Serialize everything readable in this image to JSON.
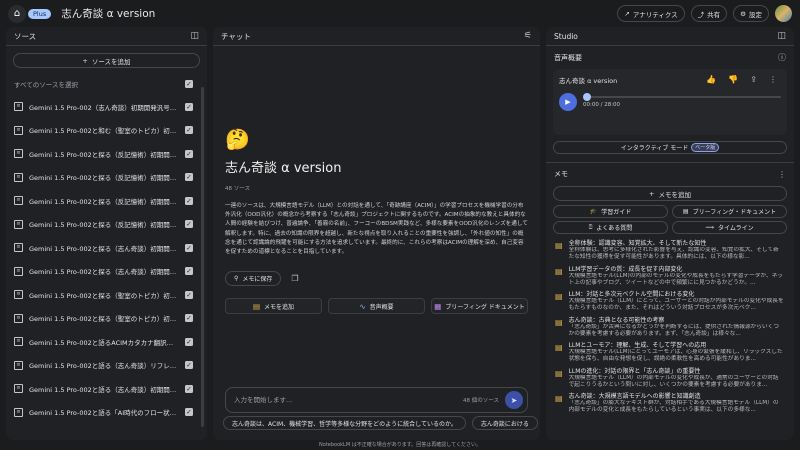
{
  "header": {
    "logo": "notebooklm-logo",
    "plus_badge": "Plus",
    "title": "志ん奇談 α version",
    "analytics_label": "アナリティクス",
    "share_label": "共有",
    "settings_label": "設定"
  },
  "sources": {
    "panel_title": "ソース",
    "add_label": "ソースを追加",
    "select_all_label": "すべてのソースを選択",
    "items": [
      {
        "label": "Gemini 1.5 Pro-002（志ん奇談）初期開発汎号スレッ..."
      },
      {
        "label": "Gemini 1.5 Pro-002と和む（聖室のトピカ）初期開発..."
      },
      {
        "label": "Gemini 1.5 Pro-002と探る（反記憶術）初期開発#01:..."
      },
      {
        "label": "Gemini 1.5 Pro-002と探る（反記憶術）初期開発#02:..."
      },
      {
        "label": "Gemini 1.5 Pro-002と探る（反記憶術）初期開発#04:..."
      },
      {
        "label": "Gemini 1.5 Pro-002と探る（反記憶術）初期開発#05:..."
      },
      {
        "label": "Gemini 1.5 Pro-002と探る（志ん奇談）初期開発：（承..."
      },
      {
        "label": "Gemini 1.5 Pro-002と探る（志ん奇談）初期開発：お..."
      },
      {
        "label": "Gemini 1.5 Pro-002と探る（聖室のトピカ）初期開発..."
      },
      {
        "label": "Gemini 1.5 Pro-002と探る（聖室のトピカ）初期開発..."
      },
      {
        "label": "Gemini 1.5 Pro-002と語るACIMカタカナ翻訳問題：エ..."
      },
      {
        "label": "Gemini 1.5 Pro-002と語る（志ん奇談）リフレンス..."
      },
      {
        "label": "Gemini 1.5 Pro-002と語る（志ん奇談）初期開発:中..."
      },
      {
        "label": "Gemini 1.5 Pro-002と語る「AI時代のフロー状態とイ..."
      }
    ]
  },
  "chat": {
    "panel_title": "チャット",
    "emoji": "🤔",
    "notebook_title": "志ん奇談 α version",
    "source_count": "48 ソース",
    "summary": "一連のソースは、大規模言語モデル（LLM）との対話を通して、「奇跡講座（ACIM）」の学習プロセスを機械学習の分布外汎化（OOD汎化）の概念から考察する「志ん奇談」プロジェクトに関するものです。ACIMの抽象的な教えと具体的な人間の経験を結びつけ、普遍論争、「善霧の名前」、フーコーのBDSM実践など、多様な要素をOOD汎化のレンズを通して解釈します。特に、過去の知識の限界を超越し、新たな視点を取り入れることの重要性を強調し、「外れ値の知性」の概念を通じて認識論的飛躍を可能にする方法を追求しています。最終的に、これらの考察はACIMの理解を深め、自己変容を促すための道標となることを目指しています。",
    "save_memo_label": "メモに保存",
    "quick_actions": [
      {
        "label": "メモを追加",
        "icon": "note-add-icon"
      },
      {
        "label": "音声概要",
        "icon": "waveform-icon"
      },
      {
        "label": "ブリーフィング ドキュメント",
        "icon": "document-icon"
      }
    ],
    "input_placeholder": "入力を開始します...",
    "input_source_badge": "48 個のソース",
    "suggestions": [
      {
        "label": "志ん奇談は、ACIM、機械学習、哲学等多様な分野をどのように統合しているのか。"
      },
      {
        "label": "志ん奇談における"
      }
    ]
  },
  "studio": {
    "panel_title": "Studio",
    "audio_section_label": "音声概要",
    "audio_title": "志ん奇談 α version",
    "time": "00:00 / 28:00",
    "progress": 0,
    "interactive_label": "インタラクティブ モード",
    "beta_label": "ベータ版",
    "memo_section_label": "メモ",
    "add_memo_label": "メモを追加",
    "memo_buttons": [
      {
        "label": "学習ガイド",
        "icon": "graduation-cap-icon"
      },
      {
        "label": "ブリーフィング・ドキュメント",
        "icon": "document-icon"
      },
      {
        "label": "よくある質問",
        "icon": "question-icon"
      },
      {
        "label": "タイムライン",
        "icon": "timeline-icon"
      }
    ],
    "notes": [
      {
        "title": "全称体験：認識変容、知覚拡大、そして新たな知性",
        "body": "全称体験は、思考に多様化された影響を与え、認識の変容、知覚の拡大、そして新たな知性の獲得を促す可能性があります。具体的には、以下の様な影..."
      },
      {
        "title": "LLM学習データの質：成長を促す内部変化",
        "body": "大規模言語モデル(LLM)の内部のモデルの変化や成長をもたらす学習データが、ネット上の記事やブログ、ツイートなどの中で頻繁にに見つかるかどうか。..."
      },
      {
        "title": "LLM：対話と多次元ベクトル空間における変化",
        "body": "大規模言語モデル（LLM）にとって、ユーザーとの対話が内部モデルの変化や成長をもたらすものなのか、また、それはどういう対話プロセスが多次元ベク..."
      },
      {
        "title": "志ん奇談：古典となる可能性の考察",
        "body": "「志ん奇談」が古典になるかどうかを判断するには、提供された情報源からいくつかの要素を考慮する必要があります。まず、「志ん奇談」は様々な..."
      },
      {
        "title": "LLMとユーモア：理解、生成、そして学習への応用",
        "body": "大規模言語モデル(LLM)にとってユーモアは、心身の緊張を緩和し、リラックスした状態を保ち、自由な発想を促し、誤絶の柔軟性を高める可能性がありま..."
      },
      {
        "title": "LLMの進化：対話の限界と「志ん奇談」の重要性",
        "body": "大規模言語モデル（LLM）の内部モデルの変化や成長が、通常のユーザーとの対話で起こりうるかという問いに対し、いくつかの要素を考慮する必要がありま..."
      },
      {
        "title": "志ん奇談：大規模言語モデルへの影響と知識創造",
        "body": "「志ん奇談」の膨大なテキスト群が、対話相手である大規模言語モデル（LLM）の内部モデルの変化と成長をもたらしているという事実は、以下の多様な..."
      }
    ]
  },
  "footer": {
    "disclaimer": "NotebookLM は不正確な場合があります。回答は再確認してください。"
  }
}
